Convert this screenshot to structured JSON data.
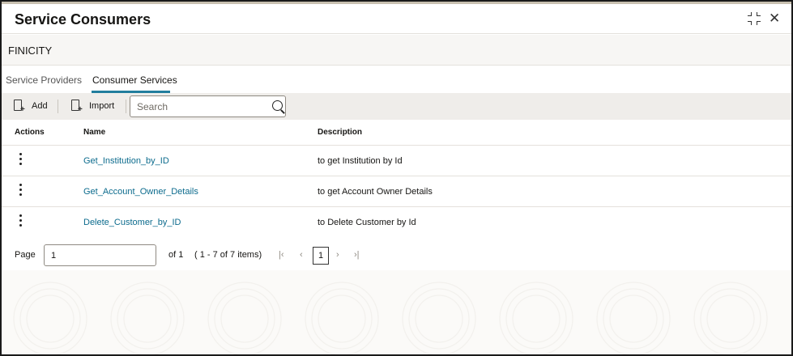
{
  "dialog": {
    "title": "Service Consumers",
    "subheader": "FINICITY"
  },
  "tabs": [
    {
      "label": "Service Providers",
      "active": false
    },
    {
      "label": "Consumer Services",
      "active": true
    }
  ],
  "toolbar": {
    "add_label": "Add",
    "import_label": "Import",
    "search_placeholder": "Search"
  },
  "table": {
    "headers": {
      "actions": "Actions",
      "name": "Name",
      "description": "Description"
    },
    "rows": [
      {
        "name": "Get_Institution_by_ID",
        "description": "to get Institution by Id"
      },
      {
        "name": "Get_Account_Owner_Details",
        "description": "to get Account Owner Details"
      },
      {
        "name": "Delete_Customer_by_ID",
        "description": "to Delete Customer by Id"
      }
    ]
  },
  "pagination": {
    "page_label": "Page",
    "page_value": "1",
    "of_label": "of 1",
    "items_summary": "( 1 - 7 of 7 items)",
    "current_page": "1"
  },
  "colors": {
    "accent": "#227e9e",
    "link": "#0c6b8d",
    "toolbar_bg": "#efedea"
  },
  "icons": [
    "expand-icon",
    "close-icon",
    "add-document-icon",
    "import-document-icon",
    "search-icon",
    "kebab-menu-icon",
    "first-page-icon",
    "previous-page-icon",
    "next-page-icon",
    "last-page-icon"
  ]
}
